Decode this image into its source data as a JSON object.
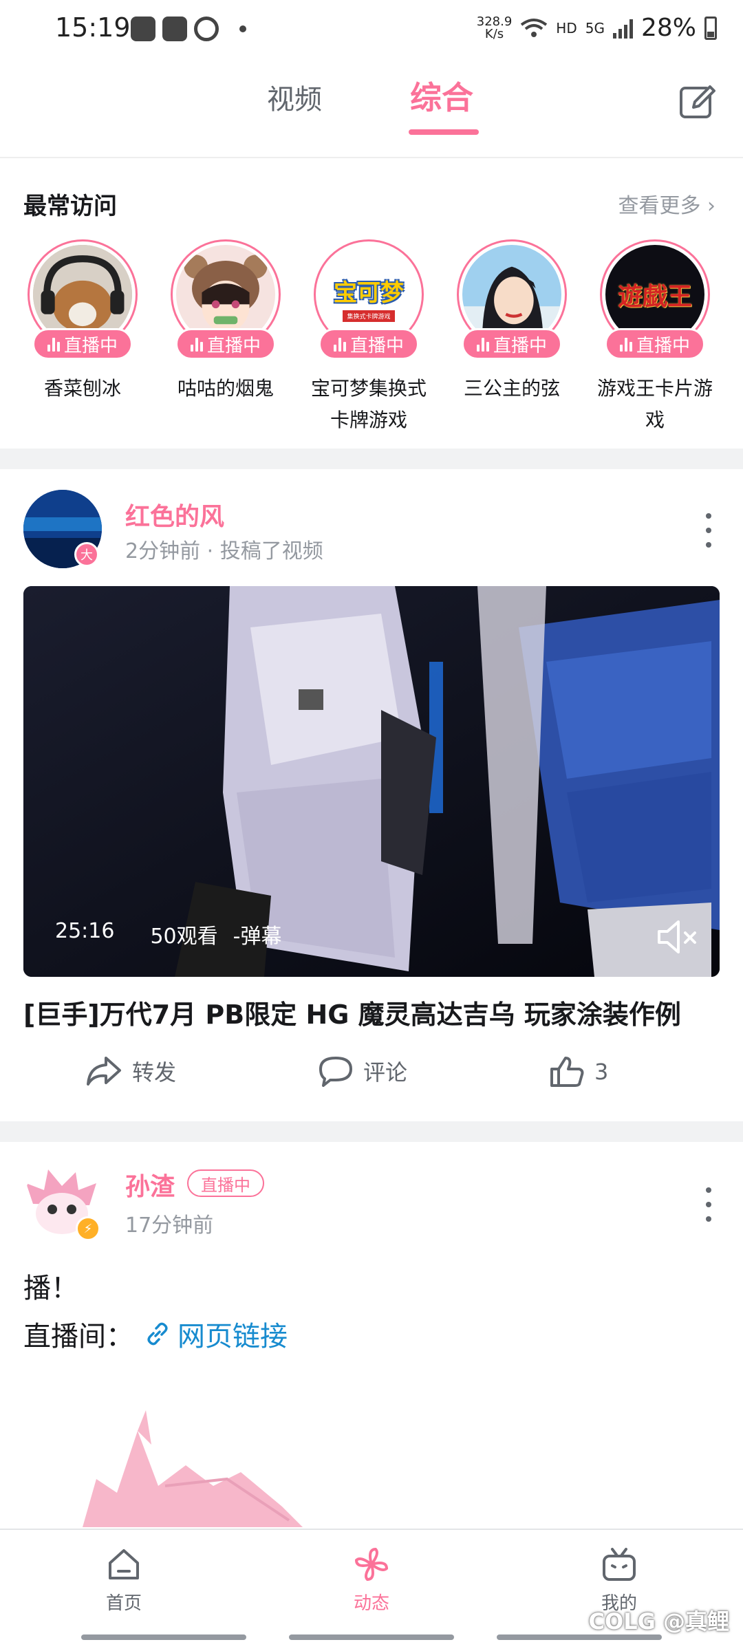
{
  "status_bar": {
    "time": "15:19",
    "net_speed_value": "328.9",
    "net_speed_unit": "K/s",
    "hd": "HD",
    "network": "5G",
    "battery": "28%"
  },
  "top_tabs": {
    "tabs": [
      {
        "label": "视频",
        "active": false
      },
      {
        "label": "综合",
        "active": true
      }
    ],
    "compose_icon": "edit-icon"
  },
  "frequent": {
    "title": "最常访问",
    "more": "查看更多 ›",
    "live_label": "直播中",
    "items": [
      {
        "name": "香菜刨冰"
      },
      {
        "name": "咕咕的烟鬼"
      },
      {
        "name": "宝可梦集换式卡牌游戏"
      },
      {
        "name": "三公主的弦"
      },
      {
        "name": "游戏王卡片游戏"
      }
    ],
    "item3_logo": "宝可梦",
    "item3_sub": "集换式卡牌游戏",
    "item5_logo": "遊戯王"
  },
  "post1": {
    "author": "红色的风",
    "badge": "大",
    "meta": "2分钟前 · 投稿了视频",
    "duration": "25:16",
    "views": "50观看",
    "danmaku": "-弹幕",
    "title": "[巨手]万代7月 PB限定 HG 魔灵高达吉乌 玩家涂装作例",
    "share": "转发",
    "comment": "评论",
    "like_count": "3"
  },
  "post2": {
    "author": "孙渣",
    "live_tag": "直播中",
    "meta": "17分钟前",
    "text_line1": "播！",
    "text_line2_prefix": "直播间：",
    "link_text": "网页链接"
  },
  "bottom_nav": {
    "items": [
      {
        "label": "首页",
        "icon": "home-icon"
      },
      {
        "label": "动态",
        "icon": "pinwheel-icon",
        "active": true
      },
      {
        "label": "我的",
        "icon": "tv-icon"
      }
    ]
  },
  "watermark": "COLG @真鲤",
  "colors": {
    "accent": "#fb7299",
    "link": "#178bcf",
    "text_primary": "#18191c",
    "text_secondary": "#9499a0"
  }
}
